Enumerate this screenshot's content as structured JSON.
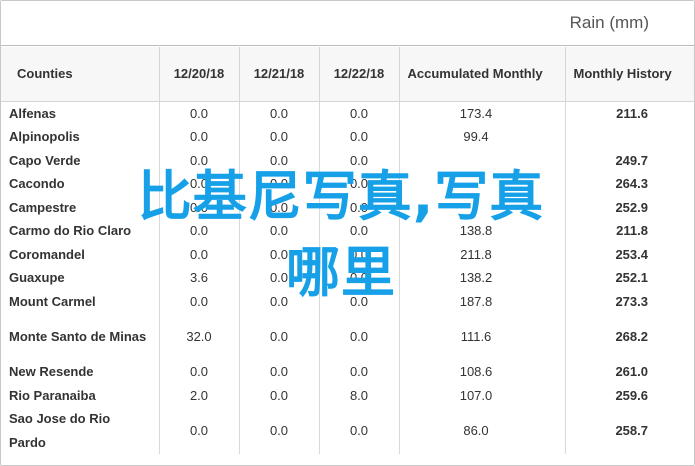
{
  "header": {
    "title": "Rain (mm)"
  },
  "columns": [
    "Counties",
    "12/20/18",
    "12/21/18",
    "12/22/18",
    "Accumulated Monthly",
    "Monthly History"
  ],
  "rows": [
    {
      "county": "Alfenas",
      "d1": "0.0",
      "d2": "0.0",
      "d3": "0.0",
      "acc": "173.4",
      "hist": "211.6"
    },
    {
      "county": "Alpinopolis",
      "d1": "0.0",
      "d2": "0.0",
      "d3": "0.0",
      "acc": "99.4",
      "hist": ""
    },
    {
      "county": "Capo Verde",
      "d1": "0.0",
      "d2": "0.0",
      "d3": "0.0",
      "acc": "",
      "hist": "249.7"
    },
    {
      "county": "Cacondo",
      "d1": "0.0",
      "d2": "0.0",
      "d3": "0.0",
      "acc": "",
      "hist": "264.3"
    },
    {
      "county": "Campestre",
      "d1": "0.0",
      "d2": "0.0",
      "d3": "0.0",
      "acc": "",
      "hist": "252.9"
    },
    {
      "county": "Carmo do Rio Claro",
      "d1": "0.0",
      "d2": "0.0",
      "d3": "0.0",
      "acc": "138.8",
      "hist": "211.8"
    },
    {
      "county": "Coromandel",
      "d1": "0.0",
      "d2": "0.0",
      "d3": "0.0",
      "acc": "211.8",
      "hist": "253.4"
    },
    {
      "county": "Guaxupe",
      "d1": "3.6",
      "d2": "0.0",
      "d3": "0.0",
      "acc": "138.2",
      "hist": "252.1"
    },
    {
      "county": "Mount Carmel",
      "d1": "0.0",
      "d2": "0.0",
      "d3": "0.0",
      "acc": "187.8",
      "hist": "273.3"
    },
    {
      "county": "Monte Santo de Minas",
      "d1": "32.0",
      "d2": "0.0",
      "d3": "0.0",
      "acc": "111.6",
      "hist": "268.2"
    },
    {
      "county": "New Resende",
      "d1": "0.0",
      "d2": "0.0",
      "d3": "0.0",
      "acc": "108.6",
      "hist": "261.0"
    },
    {
      "county": "Rio Paranaiba",
      "d1": "2.0",
      "d2": "0.0",
      "d3": "8.0",
      "acc": "107.0",
      "hist": "259.6"
    },
    {
      "county": "Sao Jose do Rio Pardo",
      "d1": "0.0",
      "d2": "0.0",
      "d3": "0.0",
      "acc": "86.0",
      "hist": "258.7"
    }
  ],
  "overlay": {
    "line1": "比基尼写真,写真",
    "line2": "哪里"
  }
}
